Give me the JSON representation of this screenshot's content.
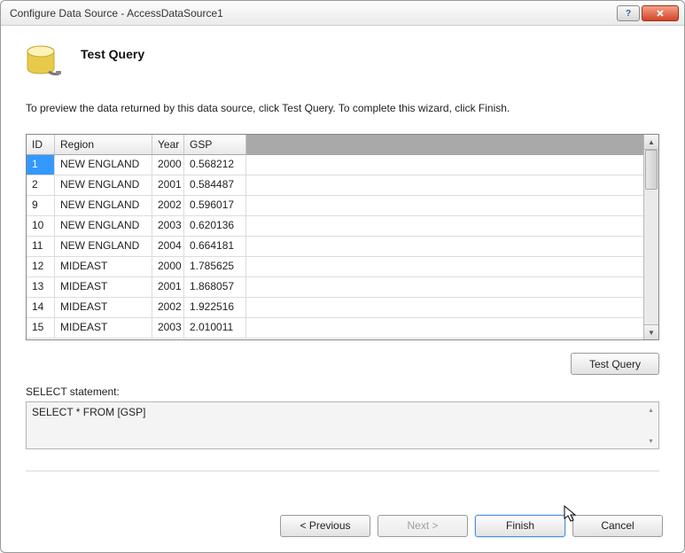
{
  "window": {
    "title": "Configure Data Source - AccessDataSource1"
  },
  "header": {
    "title": "Test Query"
  },
  "description": "To preview the data returned by this data source, click Test Query. To complete this wizard, click Finish.",
  "grid": {
    "columns": [
      "ID",
      "Region",
      "Year",
      "GSP"
    ],
    "rows": [
      {
        "id": "1",
        "region": "NEW ENGLAND",
        "year": "2000",
        "gsp": "0.568212"
      },
      {
        "id": "2",
        "region": "NEW ENGLAND",
        "year": "2001",
        "gsp": "0.584487"
      },
      {
        "id": "9",
        "region": "NEW ENGLAND",
        "year": "2002",
        "gsp": "0.596017"
      },
      {
        "id": "10",
        "region": "NEW ENGLAND",
        "year": "2003",
        "gsp": "0.620136"
      },
      {
        "id": "11",
        "region": "NEW ENGLAND",
        "year": "2004",
        "gsp": "0.664181"
      },
      {
        "id": "12",
        "region": "MIDEAST",
        "year": "2000",
        "gsp": "1.785625"
      },
      {
        "id": "13",
        "region": "MIDEAST",
        "year": "2001",
        "gsp": "1.868057"
      },
      {
        "id": "14",
        "region": "MIDEAST",
        "year": "2002",
        "gsp": "1.922516"
      },
      {
        "id": "15",
        "region": "MIDEAST",
        "year": "2003",
        "gsp": "2.010011"
      }
    ]
  },
  "buttons": {
    "testQuery": "Test Query",
    "previous": "< Previous",
    "next": "Next >",
    "finish": "Finish",
    "cancel": "Cancel"
  },
  "statement": {
    "label": "SELECT statement:",
    "value": "SELECT * FROM [GSP]"
  }
}
